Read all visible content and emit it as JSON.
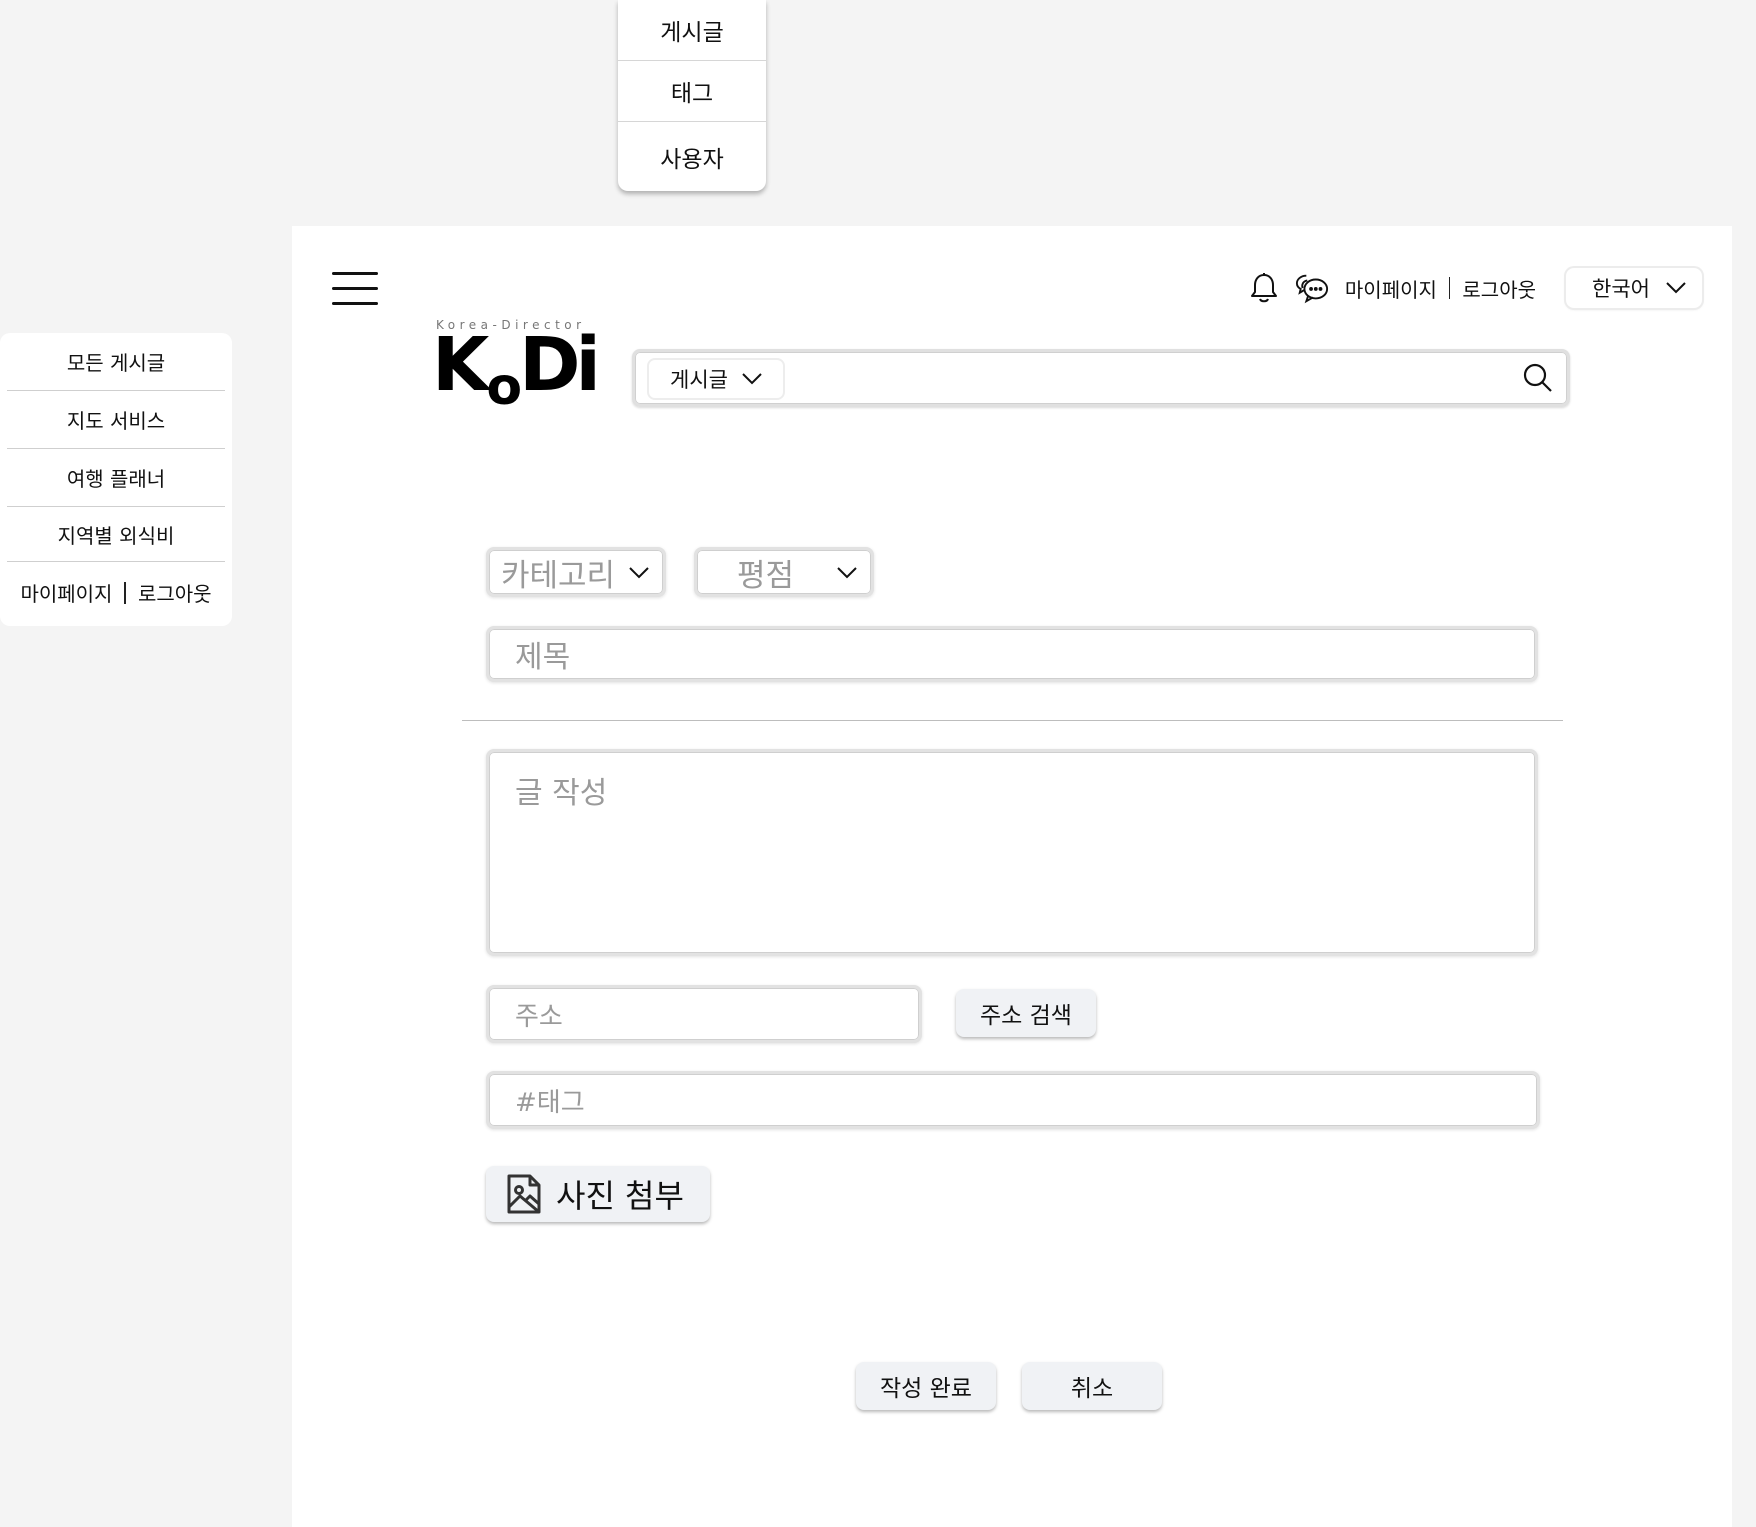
{
  "search_type_menu": {
    "options": [
      "게시글",
      "태그",
      "사용자"
    ]
  },
  "side_nav": {
    "items": [
      "모든 게시글",
      "지도 서비스",
      "여행 플래너",
      "지역별 외식비"
    ],
    "mypage": "마이페이지",
    "logout": "로그아웃"
  },
  "header": {
    "mypage": "마이페이지",
    "logout": "로그아웃",
    "language": "한국어",
    "logo_tagline": "Korea-Director",
    "logo": {
      "k": "K",
      "o": "o",
      "di": "Di"
    },
    "search_type": "게시글"
  },
  "form": {
    "category_placeholder": "카테고리",
    "rating_placeholder": "평점",
    "title_placeholder": "제목",
    "body_placeholder": "글 작성",
    "address_placeholder": "주소",
    "address_search_button": "주소 검색",
    "tag_placeholder": "#태그",
    "photo_button": "사진 첨부",
    "submit_button": "작성 완료",
    "cancel_button": "취소"
  }
}
